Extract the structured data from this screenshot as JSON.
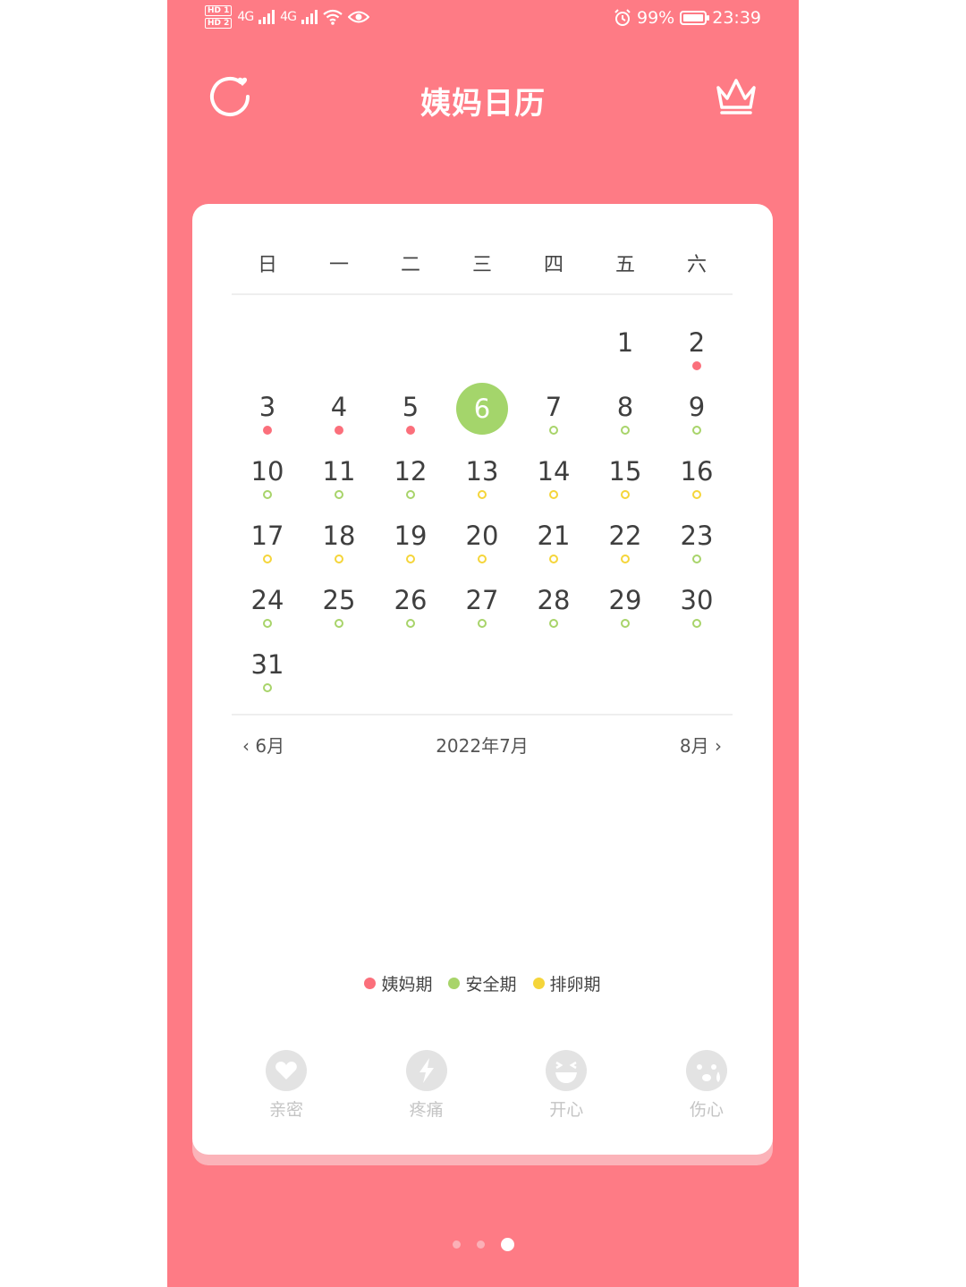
{
  "status_bar": {
    "hd1": "HD 1",
    "hd2": "HD 2",
    "signal1": "4G",
    "signal2": "4G",
    "battery": "99%",
    "time": "23:39"
  },
  "header": {
    "title": "姨妈日历",
    "left_icon": "refresh-heart-icon",
    "right_icon": "crown-icon"
  },
  "calendar": {
    "weekdays": [
      "日",
      "一",
      "二",
      "三",
      "四",
      "五",
      "六"
    ],
    "leading_blanks": 5,
    "days": [
      {
        "d": "1",
        "mark": "none"
      },
      {
        "d": "2",
        "mark": "period"
      },
      {
        "d": "3",
        "mark": "period"
      },
      {
        "d": "4",
        "mark": "period"
      },
      {
        "d": "5",
        "mark": "period"
      },
      {
        "d": "6",
        "mark": "none",
        "today": true
      },
      {
        "d": "7",
        "mark": "safe"
      },
      {
        "d": "8",
        "mark": "safe"
      },
      {
        "d": "9",
        "mark": "safe"
      },
      {
        "d": "10",
        "mark": "safe"
      },
      {
        "d": "11",
        "mark": "safe"
      },
      {
        "d": "12",
        "mark": "safe"
      },
      {
        "d": "13",
        "mark": "ovulation"
      },
      {
        "d": "14",
        "mark": "ovulation"
      },
      {
        "d": "15",
        "mark": "ovulation"
      },
      {
        "d": "16",
        "mark": "ovulation"
      },
      {
        "d": "17",
        "mark": "ovulation"
      },
      {
        "d": "18",
        "mark": "ovulation"
      },
      {
        "d": "19",
        "mark": "ovulation"
      },
      {
        "d": "20",
        "mark": "ovulation"
      },
      {
        "d": "21",
        "mark": "ovulation"
      },
      {
        "d": "22",
        "mark": "ovulation"
      },
      {
        "d": "23",
        "mark": "safe"
      },
      {
        "d": "24",
        "mark": "safe"
      },
      {
        "d": "25",
        "mark": "safe"
      },
      {
        "d": "26",
        "mark": "safe"
      },
      {
        "d": "27",
        "mark": "safe"
      },
      {
        "d": "28",
        "mark": "safe"
      },
      {
        "d": "29",
        "mark": "safe"
      },
      {
        "d": "30",
        "mark": "safe"
      },
      {
        "d": "31",
        "mark": "safe"
      }
    ],
    "prev_month": "6月",
    "current_month": "2022年7月",
    "next_month": "8月"
  },
  "legend": [
    {
      "label": "姨妈期",
      "color": "#fb6f7b"
    },
    {
      "label": "安全期",
      "color": "#a8d46a"
    },
    {
      "label": "排卵期",
      "color": "#f5d53a"
    }
  ],
  "moods": [
    {
      "label": "亲密",
      "icon": "heart-icon"
    },
    {
      "label": "疼痛",
      "icon": "lightning-icon"
    },
    {
      "label": "开心",
      "icon": "laughing-face-icon"
    },
    {
      "label": "伤心",
      "icon": "crying-face-icon"
    }
  ],
  "colors": {
    "background": "#fe7b85",
    "card": "#ffffff",
    "today": "#a4d56b",
    "mood_icon": "#e3e3e3"
  },
  "pager": {
    "count": 3,
    "active": 3
  }
}
